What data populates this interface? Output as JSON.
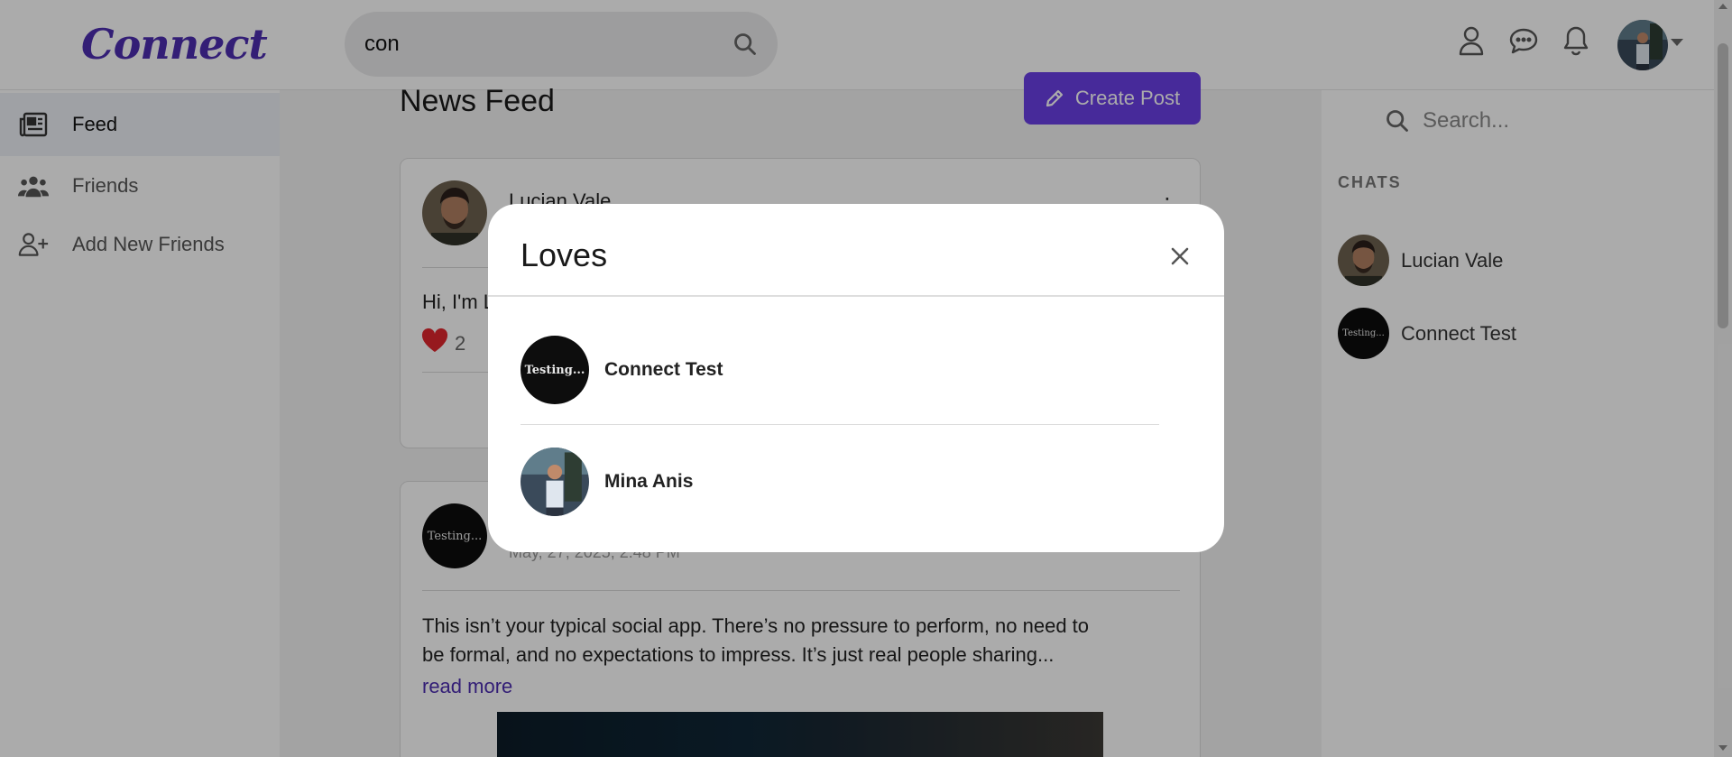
{
  "app": {
    "logo": "Connect"
  },
  "header": {
    "search": {
      "value": "con"
    }
  },
  "sidebar": {
    "items": [
      {
        "label": "Feed",
        "icon": "newspaper-icon",
        "active": true
      },
      {
        "label": "Friends",
        "icon": "users-icon",
        "active": false
      },
      {
        "label": "Add New Friends",
        "icon": "user-plus-icon",
        "active": false
      }
    ]
  },
  "feed": {
    "title": "News Feed",
    "create_post_label": "Create Post",
    "posts": [
      {
        "author": "Lucian Vale",
        "text": "Hi, I'm L",
        "loves": "2"
      },
      {
        "author_avatar_text": "Testing...",
        "date": "May, 27, 2025, 2:48 PM",
        "text_line1": "This isn’t your typical social app. There’s no pressure to perform, no need to",
        "text_line2": "be formal, and no expectations to impress. It’s just real people sharing...",
        "read_more": "read more"
      }
    ]
  },
  "right_panel": {
    "search_placeholder": "Search...",
    "chats_label": "CHATS",
    "chats": [
      {
        "name": "Lucian Vale"
      },
      {
        "name": "Connect Test",
        "avatar_text": "Testing..."
      }
    ]
  },
  "modal": {
    "title": "Loves",
    "people": [
      {
        "name": "Connect Test",
        "avatar_text": "Testing..."
      },
      {
        "name": "Mina Anis"
      }
    ]
  },
  "colors": {
    "brand": "#4c2db0",
    "button": "#6a3fe6",
    "heart": "#e0262d"
  }
}
